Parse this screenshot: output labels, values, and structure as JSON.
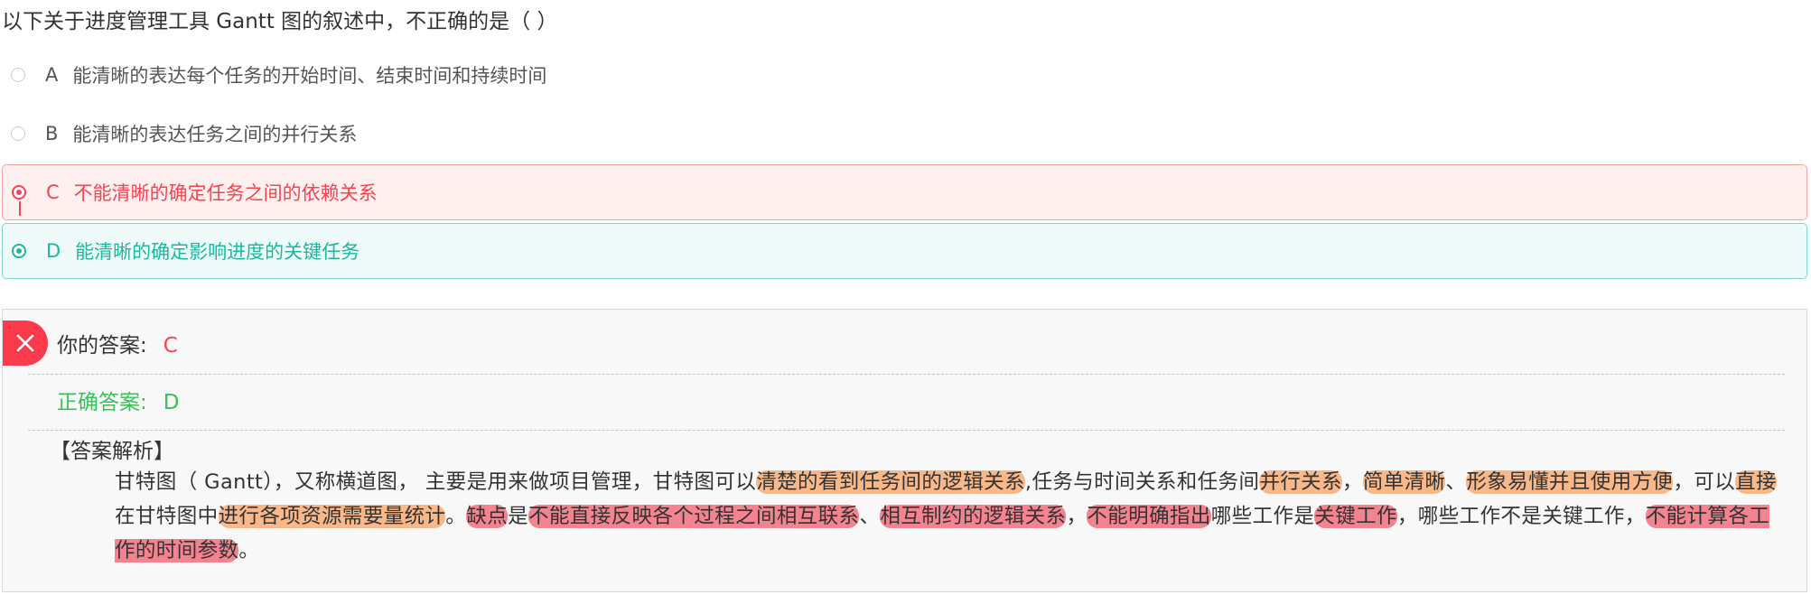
{
  "question": {
    "title": "以下关于进度管理工具 Gantt 图的叙述中，不正确的是（ ）"
  },
  "options": [
    {
      "letter": "A",
      "text": "能清晰的表达每个任务的开始时间、结束时间和持续时间"
    },
    {
      "letter": "B",
      "text": "能清晰的表达任务之间的并行关系"
    },
    {
      "letter": "C",
      "text": "不能清晰的确定任务之间的依赖关系"
    },
    {
      "letter": "D",
      "text": "能清晰的确定影响进度的关键任务"
    }
  ],
  "result": {
    "your_answer_label": "你的答案:",
    "your_answer_value": "C",
    "correct_answer_label": "正确答案:",
    "correct_answer_value": "D"
  },
  "analysis": {
    "heading": "【答案解析】",
    "segments": [
      "甘特图（ Gantt），又称横道图， 主要是用来做项目管理，甘特图可以",
      "清楚的看到任务间的逻辑关系",
      ",任务与时间关系和任务间",
      "并行关系",
      "，",
      "简单清晰",
      "、",
      "形象易懂并且使用方便",
      "，可以",
      "直接",
      "在甘特图中",
      "进行各项资源需要量统计",
      "。",
      "缺点",
      "是",
      "不能直接反映各个过程之间相互联系",
      "、",
      "相互制约的逻辑关系",
      "，",
      "不能明确指出",
      "哪些工作是",
      "关键工作",
      "，哪些工作不是关键工作，",
      "不能计算各工作的时间参数",
      "。"
    ]
  },
  "colors": {
    "wrong": "#f5444e",
    "correct_option": "#1bb89f",
    "correct_answer": "#3cbf5a",
    "highlight_orange": "#f9b88a",
    "highlight_red": "#f2838f"
  }
}
